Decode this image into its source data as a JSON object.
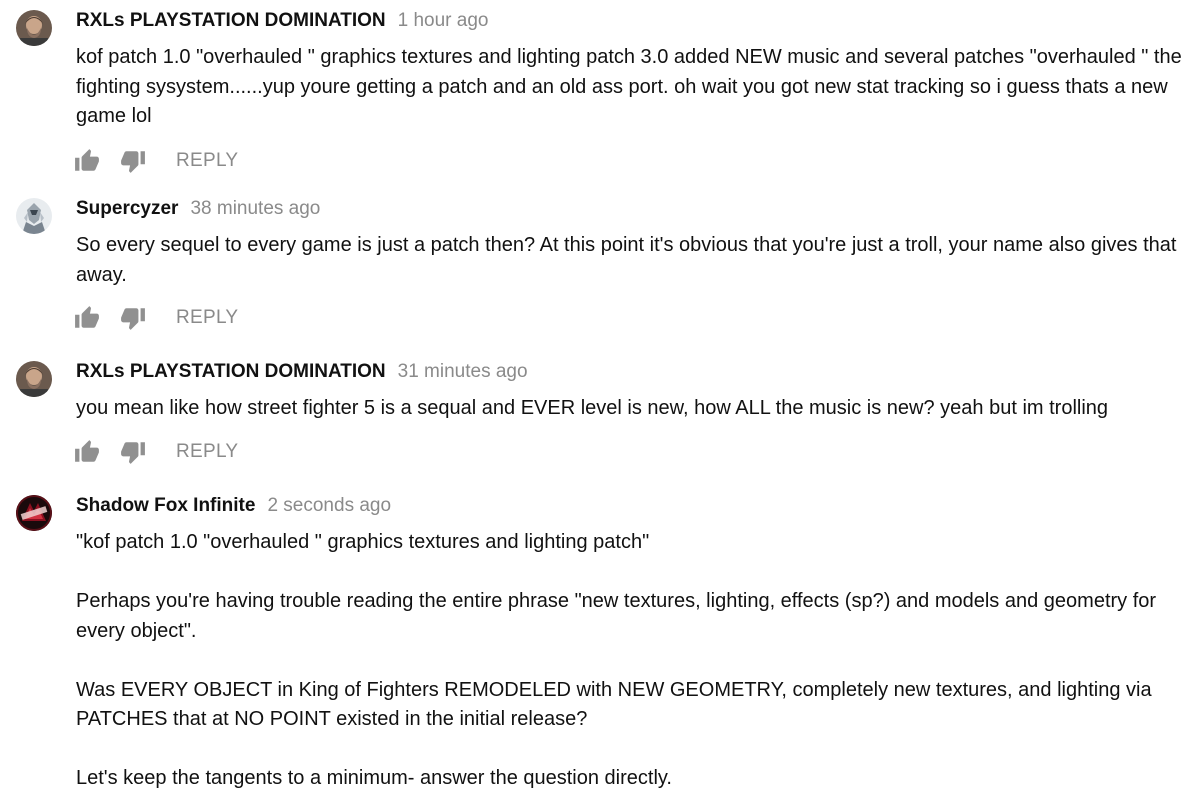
{
  "comments": [
    {
      "author": "RXLs PLAYSTATION DOMINATION",
      "time": "1 hour ago",
      "paragraphs": [
        "kof patch 1.0 \"overhauled \" graphics textures and lighting patch 3.0 added NEW music and several patches \"overhauled \" the fighting sysystem......yup youre getting a patch and an old ass port. oh wait you got new stat tracking so i guess thats a new game lol"
      ],
      "avatar_icon": "bearded-man-avatar",
      "reply_label": "REPLY"
    },
    {
      "author": "Supercyzer",
      "time": "38 minutes ago",
      "paragraphs": [
        "So every sequel to every game is just a patch then? At this point it's obvious that you're just a troll, your name also gives that away."
      ],
      "avatar_icon": "armored-figure-avatar",
      "reply_label": "REPLY"
    },
    {
      "author": "RXLs PLAYSTATION DOMINATION",
      "time": "31 minutes ago",
      "paragraphs": [
        "you mean like how street fighter 5 is a sequal and EVER level is new, how ALL the music is new? yeah but im trolling"
      ],
      "avatar_icon": "bearded-man-avatar",
      "reply_label": "REPLY"
    },
    {
      "author": "Shadow Fox Infinite",
      "time": "2 seconds ago",
      "paragraphs": [
        "\"kof patch 1.0 \"overhauled \" graphics textures and lighting patch\"",
        "Perhaps you're having trouble reading the entire phrase \"new textures, lighting, effects (sp?) and models and geometry for every object\".",
        "Was EVERY OBJECT in King of Fighters REMODELED with NEW GEOMETRY, completely new textures, and lighting via PATCHES that at NO POINT existed in the initial release?",
        "Let's keep the tangents to a minimum- answer the question directly."
      ],
      "avatar_icon": "fox-logo-avatar"
    }
  ],
  "icons": {
    "like": "thumbs-up-icon",
    "dislike": "thumbs-down-icon"
  },
  "colors": {
    "author": "#111111",
    "meta": "#8a8a8a",
    "icon": "#909090"
  }
}
